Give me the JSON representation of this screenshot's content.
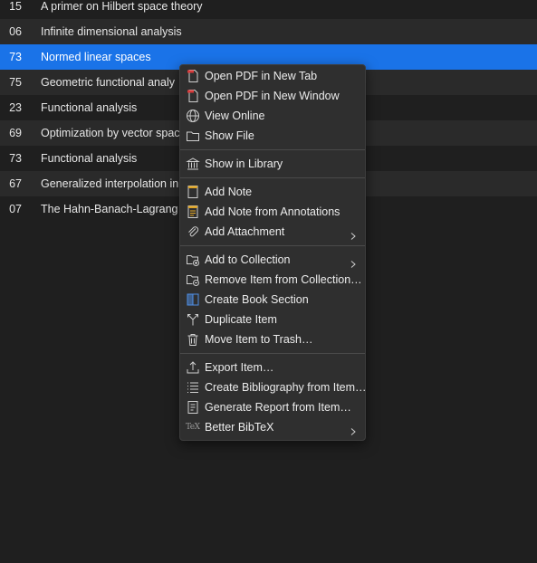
{
  "rows": [
    {
      "year": "15",
      "title": "A primer on Hilbert space theory"
    },
    {
      "year": "06",
      "title": "Infinite dimensional analysis"
    },
    {
      "year": "73",
      "title": "Normed linear spaces"
    },
    {
      "year": "75",
      "title": "Geometric functional analy"
    },
    {
      "year": "23",
      "title": "Functional analysis"
    },
    {
      "year": "69",
      "title": "Optimization by vector spac"
    },
    {
      "year": "73",
      "title": "Functional analysis"
    },
    {
      "year": "67",
      "title": "Generalized interpolation in"
    },
    {
      "year": "07",
      "title": "The Hahn-Banach-Lagrang"
    }
  ],
  "context_menu": {
    "open_pdf_new_tab": "Open PDF in New Tab",
    "open_pdf_new_window": "Open PDF in New Window",
    "view_online": "View Online",
    "show_file": "Show File",
    "show_in_library": "Show in Library",
    "add_note": "Add Note",
    "add_note_from_annotations": "Add Note from Annotations",
    "add_attachment": "Add Attachment",
    "add_to_collection": "Add to Collection",
    "remove_from_collection": "Remove Item from Collection…",
    "create_book_section": "Create Book Section",
    "duplicate_item": "Duplicate Item",
    "move_to_trash": "Move Item to Trash…",
    "export_item": "Export Item…",
    "create_bibliography": "Create Bibliography from Item…",
    "generate_report": "Generate Report from Item…",
    "better_bibtex": "Better BibTeX",
    "tex_glyph": "TeX"
  },
  "colors": {
    "background": "#1f1f1f",
    "row_alt": "#2a2a2a",
    "selection": "#1a73e8",
    "menu_bg": "#2f2f2f",
    "pdf_accent": "#d93a3a",
    "note_accent": "#e0a526",
    "book_accent": "#4f8fe6"
  }
}
